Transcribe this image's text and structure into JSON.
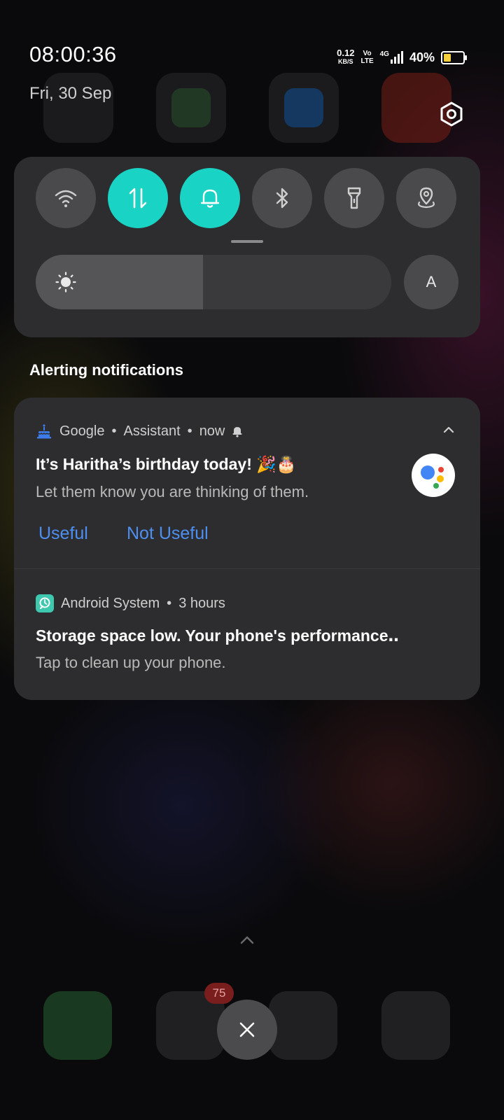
{
  "status_bar": {
    "time": "08:00:36",
    "date": "Fri, 30 Sep",
    "net_speed_value": "0.12",
    "net_speed_unit": "KB/S",
    "volte_top": "Vo",
    "volte_bottom": "LTE",
    "network_type": "4G",
    "battery_percent": "40%",
    "battery_level_fraction": 0.4,
    "battery_color": "#f4d03f"
  },
  "quick_settings": {
    "tiles": [
      {
        "name": "wifi",
        "icon": "wifi-icon",
        "active": false
      },
      {
        "name": "mobile-data",
        "icon": "data-transfer-icon",
        "active": true
      },
      {
        "name": "sound",
        "icon": "bell-icon",
        "active": true
      },
      {
        "name": "bluetooth",
        "icon": "bluetooth-icon",
        "active": false
      },
      {
        "name": "flashlight",
        "icon": "flashlight-icon",
        "active": false
      },
      {
        "name": "location",
        "icon": "location-icon",
        "active": false
      }
    ],
    "brightness_level": 0.47,
    "auto_brightness_label": "A",
    "accent_color": "#19d3c5"
  },
  "notifications": {
    "section_title": "Alerting notifications",
    "items": [
      {
        "app_name": "Google",
        "sub_text": "Assistant",
        "time": "now",
        "title": "It’s Haritha’s birthday today! 🎉🎂",
        "body": "Let them know you are thinking of them.",
        "actions": [
          "Useful",
          "Not Useful"
        ],
        "icon": "birthday-cake-icon"
      },
      {
        "app_name": "Android System",
        "time": "3 hours",
        "title": "Storage space low. Your phone's performance‥",
        "body": "Tap to clean up your phone.",
        "icon": "android-system-icon"
      }
    ],
    "separator": "•",
    "action_color": "#4d8ff0"
  },
  "home_hint": {
    "messages_badge": "75"
  }
}
